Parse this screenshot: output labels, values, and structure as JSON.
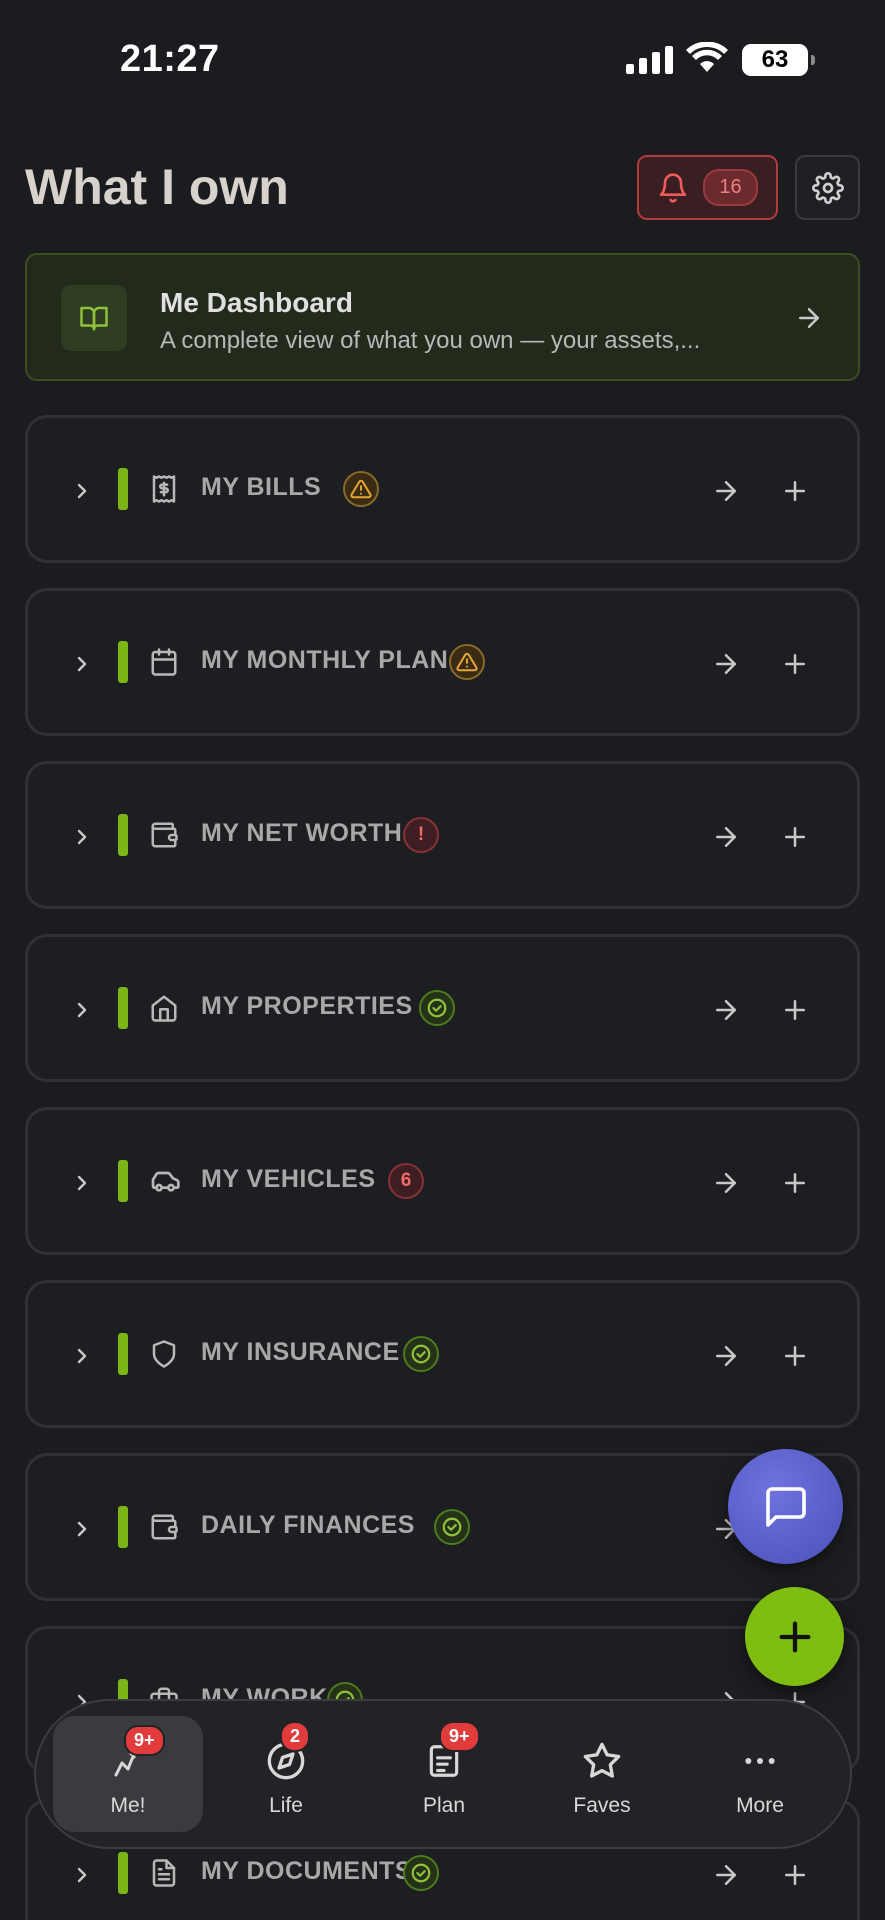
{
  "status_bar": {
    "time": "21:27",
    "battery": "63"
  },
  "header": {
    "title": "What I own",
    "notifications_count": "16"
  },
  "dashboard": {
    "title": "Me Dashboard",
    "description": "A complete view of what you own — your assets,..."
  },
  "sections": [
    {
      "label": "MY BILLS",
      "icon": "receipt-icon",
      "status": "warning",
      "badge": ""
    },
    {
      "label": "MY MONTHLY PLAN",
      "icon": "calendar-icon",
      "status": "warning",
      "badge": ""
    },
    {
      "label": "MY NET WORTH",
      "icon": "wallet-icon",
      "status": "error",
      "badge": "!"
    },
    {
      "label": "MY PROPERTIES",
      "icon": "home-icon",
      "status": "ok",
      "badge": ""
    },
    {
      "label": "MY VEHICLES",
      "icon": "car-icon",
      "status": "count",
      "badge": "6"
    },
    {
      "label": "MY INSURANCE",
      "icon": "shield-icon",
      "status": "ok",
      "badge": ""
    },
    {
      "label": "DAILY FINANCES",
      "icon": "wallet-icon",
      "status": "ok",
      "badge": ""
    },
    {
      "label": "MY WORK",
      "icon": "briefcase-icon",
      "status": "ok",
      "badge": ""
    },
    {
      "label": "MY DOCUMENTS",
      "icon": "document-icon",
      "status": "ok",
      "badge": ""
    }
  ],
  "nav": [
    {
      "label": "Me!",
      "badge": "9+",
      "icon": "me-icon",
      "active": true
    },
    {
      "label": "Life",
      "badge": "2",
      "icon": "compass-icon",
      "active": false
    },
    {
      "label": "Plan",
      "badge": "9+",
      "icon": "plan-icon",
      "active": false
    },
    {
      "label": "Faves",
      "badge": "",
      "icon": "star-icon",
      "active": false
    },
    {
      "label": "More",
      "badge": "",
      "icon": "more-icon",
      "active": false
    }
  ],
  "colors": {
    "accent_green": "#7cb518",
    "warning": "#e5a532",
    "error": "#f06a6a",
    "chat_fab": "#5a5fcc"
  }
}
